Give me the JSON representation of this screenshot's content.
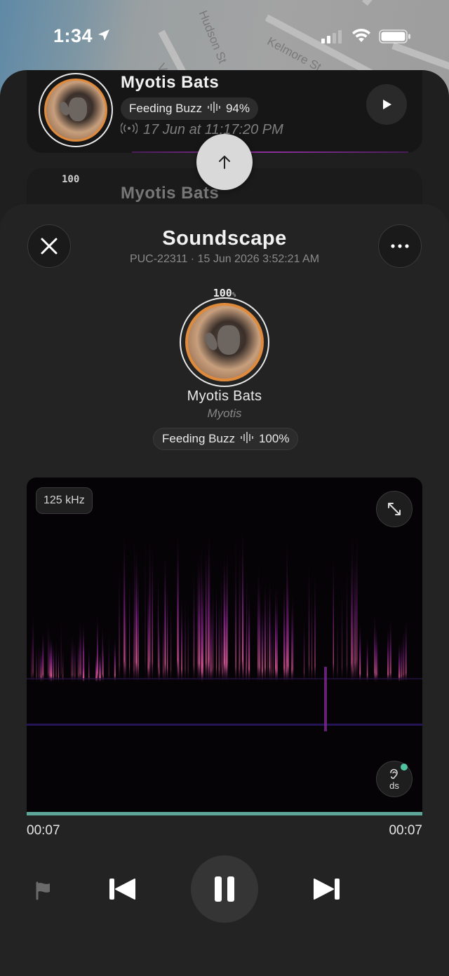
{
  "status_bar": {
    "time": "1:34"
  },
  "map": {
    "streets": [
      "Hudson St",
      "Kelmore St",
      "Va"
    ]
  },
  "top_card": {
    "title": "Myotis Bats",
    "badge_label": "Feeding Buzz",
    "badge_percent": "94%",
    "timestamp": "17 Jun at 11:17:20 PM"
  },
  "second_card": {
    "title": "Myotis Bats",
    "percent": "100"
  },
  "sheet": {
    "title": "Soundscape",
    "subtitle": "PUC-22311 · 15 Jun 2026 3:52:21 AM",
    "confidence": "100",
    "confidence_unit": "%",
    "species": "Myotis Bats",
    "genus": "Myotis",
    "call_label": "Feeding Buzz",
    "call_percent": "100%"
  },
  "spectrogram": {
    "max_frequency": "125 kHz",
    "ds_label": "ds",
    "time_start": "00:07",
    "time_end": "00:07",
    "accent_color": "#5fa69a"
  },
  "colors": {
    "sheet_bg": "#232323",
    "ring": "#e08a3c",
    "indicator": "#4fc3a1"
  }
}
